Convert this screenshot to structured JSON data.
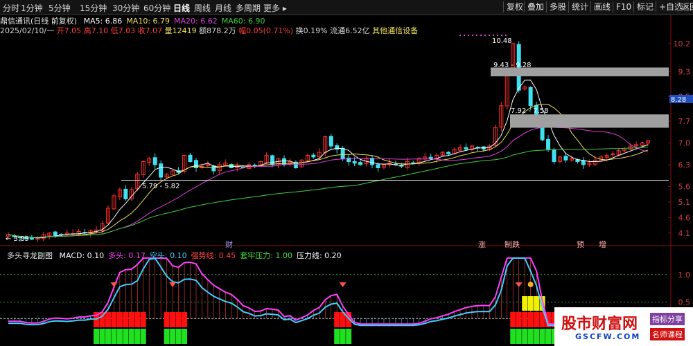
{
  "toolbar": {
    "tabs": [
      "分时",
      "1分钟",
      "5分钟",
      "15分钟",
      "30分钟",
      "60分钟",
      "日线",
      "周线",
      "月线",
      "多周期",
      "更多"
    ],
    "active_tab": "日线",
    "right_buttons": [
      "复权",
      "叠加",
      "多股",
      "统计",
      "画线",
      "F10",
      "标记",
      "+自选",
      "返回"
    ]
  },
  "header": {
    "title": "鼎信通讯(日线 前复权)",
    "ma": [
      {
        "label": "MA5: 6.86",
        "color": "#ffffff"
      },
      {
        "label": "MA10: 6.79",
        "color": "#f0e05a"
      },
      {
        "label": "MA20: 6.62",
        "color": "#e040e0"
      },
      {
        "label": "MA60: 6.90",
        "color": "#40d040"
      }
    ],
    "quote": [
      {
        "text": "2025/02/10/一 ",
        "color": "#d8d8d8"
      },
      {
        "text": "开7.05 ",
        "color": "#ff4040"
      },
      {
        "text": "高7.10 ",
        "color": "#ff4040"
      },
      {
        "text": "低7.03 ",
        "color": "#ff4040"
      },
      {
        "text": "收7.07 ",
        "color": "#ff4040"
      },
      {
        "text": "量12419 ",
        "color": "#f0e05a"
      },
      {
        "text": "额878.2万 ",
        "color": "#d8d8d8"
      },
      {
        "text": "幅0.05(0.71%) ",
        "color": "#ff4040"
      },
      {
        "text": "换0.19% ",
        "color": "#d8d8d8"
      },
      {
        "text": "流通6.52亿 ",
        "color": "#d8d8d8"
      },
      {
        "text": "其他通信设备",
        "color": "#f0e05a"
      }
    ]
  },
  "indicator_header": {
    "name": "多头寻龙副图",
    "items": [
      {
        "text": "MACD: 0.10",
        "color": "#ffffff"
      },
      {
        "text": "多头: 0.17",
        "color": "#ff40ff"
      },
      {
        "text": "空头: 0.10",
        "color": "#40d0ff"
      },
      {
        "text": "强势线: 0.45",
        "color": "#ff4040"
      },
      {
        "text": "套牢压力: 1.00",
        "color": "#40e040"
      },
      {
        "text": "压力线: 0.20",
        "color": "#ffffff"
      }
    ]
  },
  "annotations": {
    "high": "10.48",
    "zone1": "9.43 - 9.28",
    "zone2": "7.92 - 7.58",
    "zone3": "5.79 - 5.82",
    "low": "3.89",
    "current_price": "8.28",
    "markers": [
      "财",
      "涨",
      "制跌",
      "预",
      "增"
    ]
  },
  "watermark": {
    "main": "股市财富网",
    "sub": "GSCFW.COM",
    "tag1": "指标分享",
    "tag2": "名师课程"
  },
  "chart_data": [
    {
      "type": "candlestick",
      "title": "鼎信通讯(日线 前复权)",
      "date": "2025/02/10",
      "last_bar": {
        "open": 7.05,
        "high": 7.1,
        "low": 7.03,
        "close": 7.07,
        "volume": 12419
      },
      "y_ticks": [
        10.2,
        9.3,
        8.5,
        7.7,
        7.0,
        6.3,
        5.6,
        5.1,
        4.6,
        4.1
      ],
      "ylim": [
        3.85,
        10.6
      ],
      "closes": [
        4.05,
        3.98,
        3.95,
        3.92,
        3.9,
        3.95,
        4.05,
        4.1,
        4.02,
        4.05,
        4.1,
        4.08,
        4.15,
        4.12,
        4.18,
        4.2,
        4.4,
        4.9,
        5.3,
        5.5,
        5.2,
        5.5,
        6.0,
        6.4,
        6.5,
        6.3,
        5.9,
        6.0,
        6.1,
        6.05,
        6.6,
        6.4,
        6.2,
        6.25,
        6.3,
        6.1,
        6.3,
        6.35,
        6.2,
        6.25,
        6.2,
        6.3,
        6.25,
        6.4,
        6.6,
        6.3,
        6.5,
        6.3,
        6.4,
        6.2,
        6.45,
        6.6,
        6.55,
        6.7,
        7.2,
        6.9,
        6.8,
        6.5,
        6.4,
        6.35,
        6.3,
        6.5,
        6.3,
        6.2,
        6.3,
        6.35,
        6.3,
        6.25,
        6.4,
        6.35,
        6.5,
        6.55,
        6.5,
        6.6,
        6.7,
        6.65,
        6.8,
        6.85,
        6.8,
        6.9,
        6.85,
        6.8,
        6.9,
        7.5,
        8.2,
        9.2,
        10.2,
        8.7,
        8.8,
        8.2,
        7.7,
        7.1,
        6.8,
        6.4,
        6.55,
        6.45,
        6.5,
        6.4,
        6.3,
        6.35,
        6.45,
        6.55,
        6.6,
        6.65,
        6.75,
        6.8,
        6.9,
        6.95,
        7.0,
        7.07
      ]
    },
    {
      "type": "line",
      "title": "多头寻龙副图",
      "series": [
        {
          "name": "多头",
          "color": "#ff40ff"
        },
        {
          "name": "空头",
          "color": "#40d0ff"
        }
      ],
      "values": [
        {
          "name": "MACD",
          "value": 0.1
        },
        {
          "name": "多头",
          "value": 0.17
        },
        {
          "name": "空头",
          "value": 0.1
        },
        {
          "name": "强势线",
          "value": 0.45
        },
        {
          "name": "套牢压力",
          "value": 1.0
        },
        {
          "name": "压力线",
          "value": 0.2
        }
      ],
      "y_ticks": [
        1.0,
        0.5
      ],
      "ylim": [
        -0.3,
        1.4
      ]
    }
  ]
}
